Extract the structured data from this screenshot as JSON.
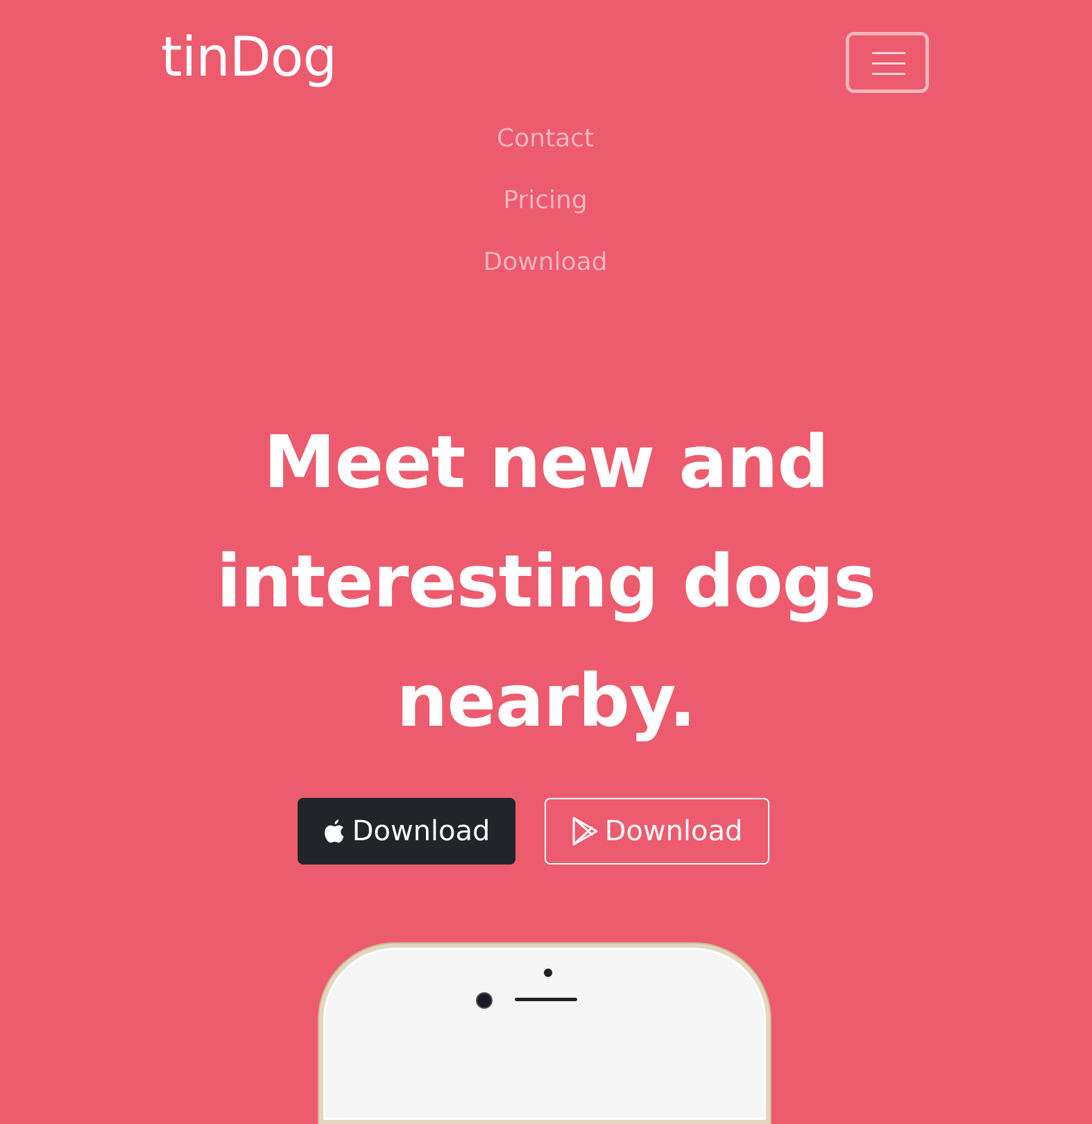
{
  "brand": {
    "name": "tinDog"
  },
  "navbar": {
    "toggler_icon": "hamburger-icon",
    "links": [
      {
        "label": "Contact"
      },
      {
        "label": "Pricing"
      },
      {
        "label": "Download"
      }
    ]
  },
  "hero": {
    "title_lines": [
      "Meet new and",
      "interesting dogs",
      "nearby."
    ],
    "buttons": [
      {
        "label": "Download",
        "icon": "apple-icon"
      },
      {
        "label": "Download",
        "icon": "google-play-icon"
      }
    ]
  },
  "colors": {
    "background": "#ed5b6e",
    "dark_button": "#212529",
    "text": "#ffffff"
  }
}
